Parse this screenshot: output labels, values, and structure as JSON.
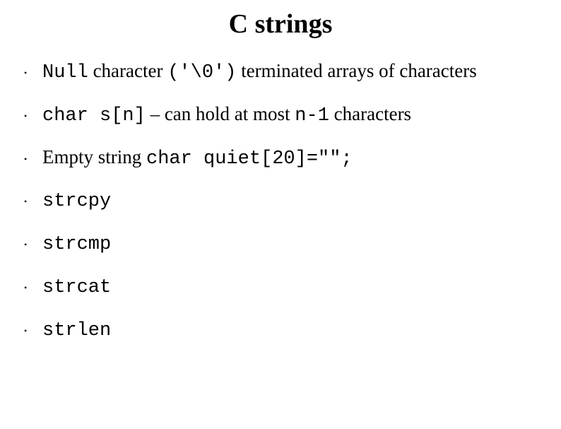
{
  "title": "C strings",
  "bullets": {
    "b1": {
      "t1": "Null",
      "t2": " character ",
      "t3": "('\\0')",
      "t4": " terminated arrays of characters"
    },
    "b2": {
      "t1": "char s[n]",
      "t2": " – can hold at most ",
      "t3": "n-1",
      "t4": " characters"
    },
    "b3": {
      "t1": "Empty string ",
      "t2": "char quiet[20]=\"\";"
    },
    "b4": {
      "t1": "strcpy"
    },
    "b5": {
      "t1": "strcmp"
    },
    "b6": {
      "t1": "strcat"
    },
    "b7": {
      "t1": "strlen"
    }
  }
}
